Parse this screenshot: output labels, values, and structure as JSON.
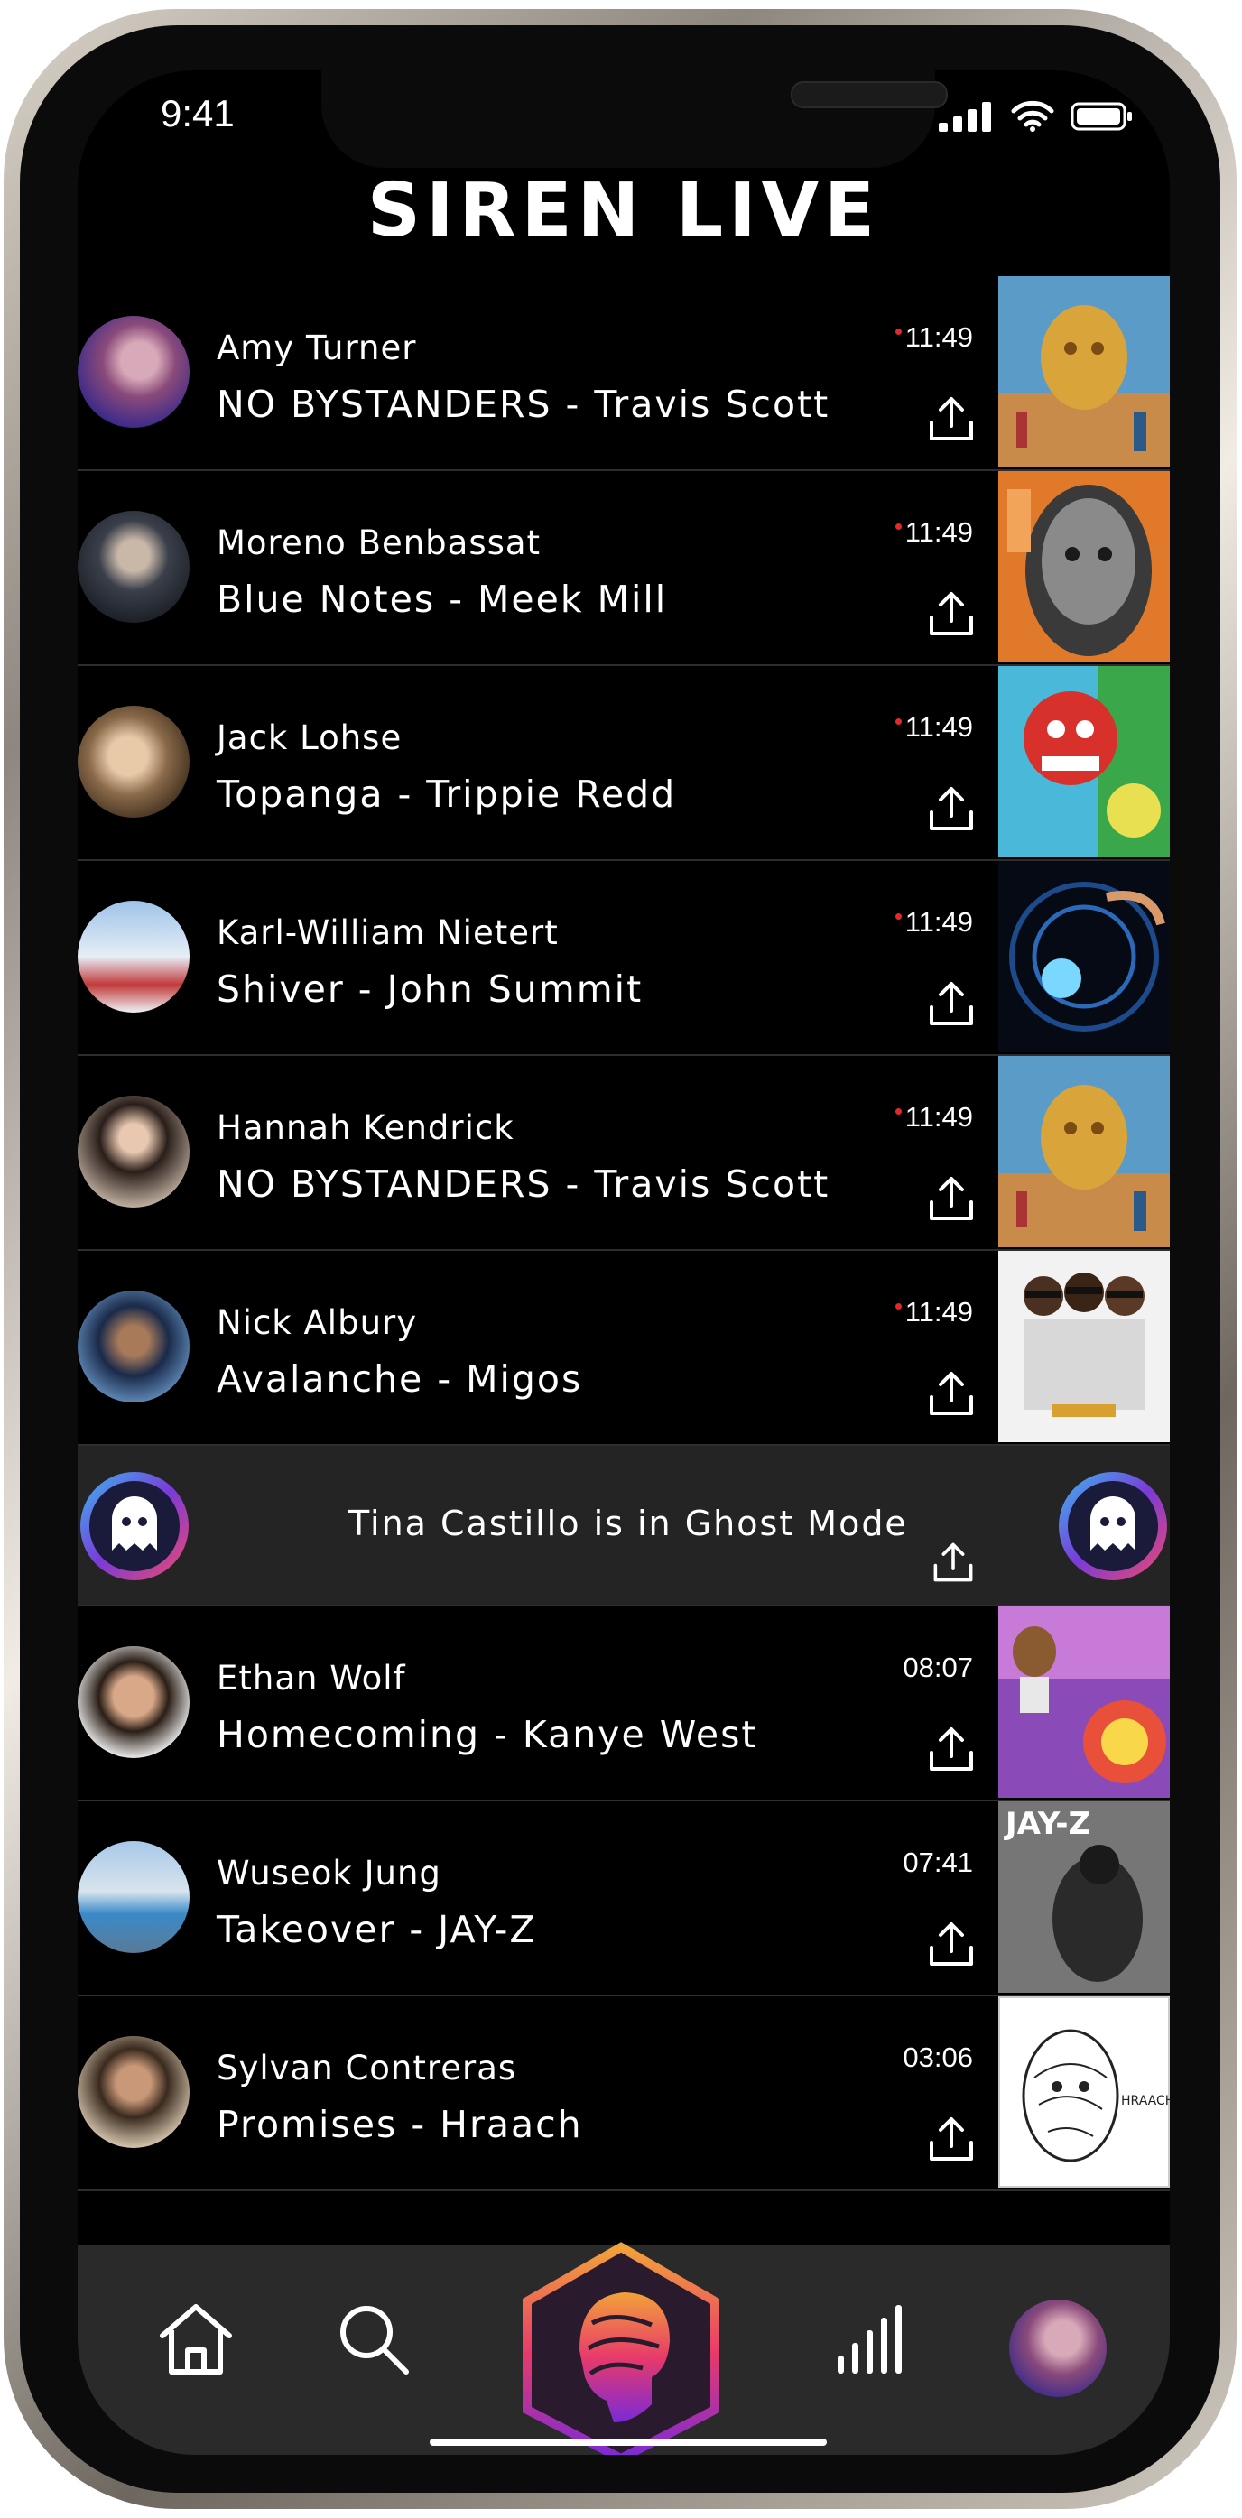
{
  "status_bar": {
    "time": "9:41"
  },
  "app": {
    "title": "SIREN LIVE"
  },
  "feed": [
    {
      "user": "Amy Turner",
      "song": "NO BYSTANDERS - Travis Scott",
      "time": "11:49",
      "live": true
    },
    {
      "user": "Moreno Benbassat",
      "song": "Blue Notes - Meek Mill",
      "time": "11:49",
      "live": true
    },
    {
      "user": "Jack Lohse",
      "song": "Topanga - Trippie Redd",
      "time": "11:49",
      "live": true
    },
    {
      "user": "Karl-William Nietert",
      "song": "Shiver - John Summit",
      "time": "11:49",
      "live": true
    },
    {
      "user": "Hannah Kendrick",
      "song": "NO BYSTANDERS - Travis Scott",
      "time": "11:49",
      "live": true
    },
    {
      "user": "Nick Albury",
      "song": "Avalanche - Migos",
      "time": "11:49",
      "live": true
    }
  ],
  "ghost": {
    "text": "Tina Castillo is in Ghost Mode"
  },
  "feed_after": [
    {
      "user": "Ethan Wolf",
      "song": "Homecoming - Kanye West",
      "time": "08:07",
      "live": false
    },
    {
      "user": "Wuseok Jung",
      "song": "Takeover - JAY-Z",
      "time": "07:41",
      "live": false
    },
    {
      "user": "Sylvan Contreras",
      "song": "Promises - Hraach",
      "time": "03:06",
      "live": false
    }
  ],
  "covers": {
    "jayz_title": "JAY-Z",
    "hraach_title": "HRAACH"
  },
  "tabs": [
    "home-icon",
    "search-icon",
    "siren-logo",
    "activity-bars-icon",
    "profile-avatar"
  ],
  "colors": {
    "background": "#000000",
    "live_dot": "#e02a2a",
    "ghost_row": "#242424",
    "tab_bar": "#2a2a2a"
  }
}
